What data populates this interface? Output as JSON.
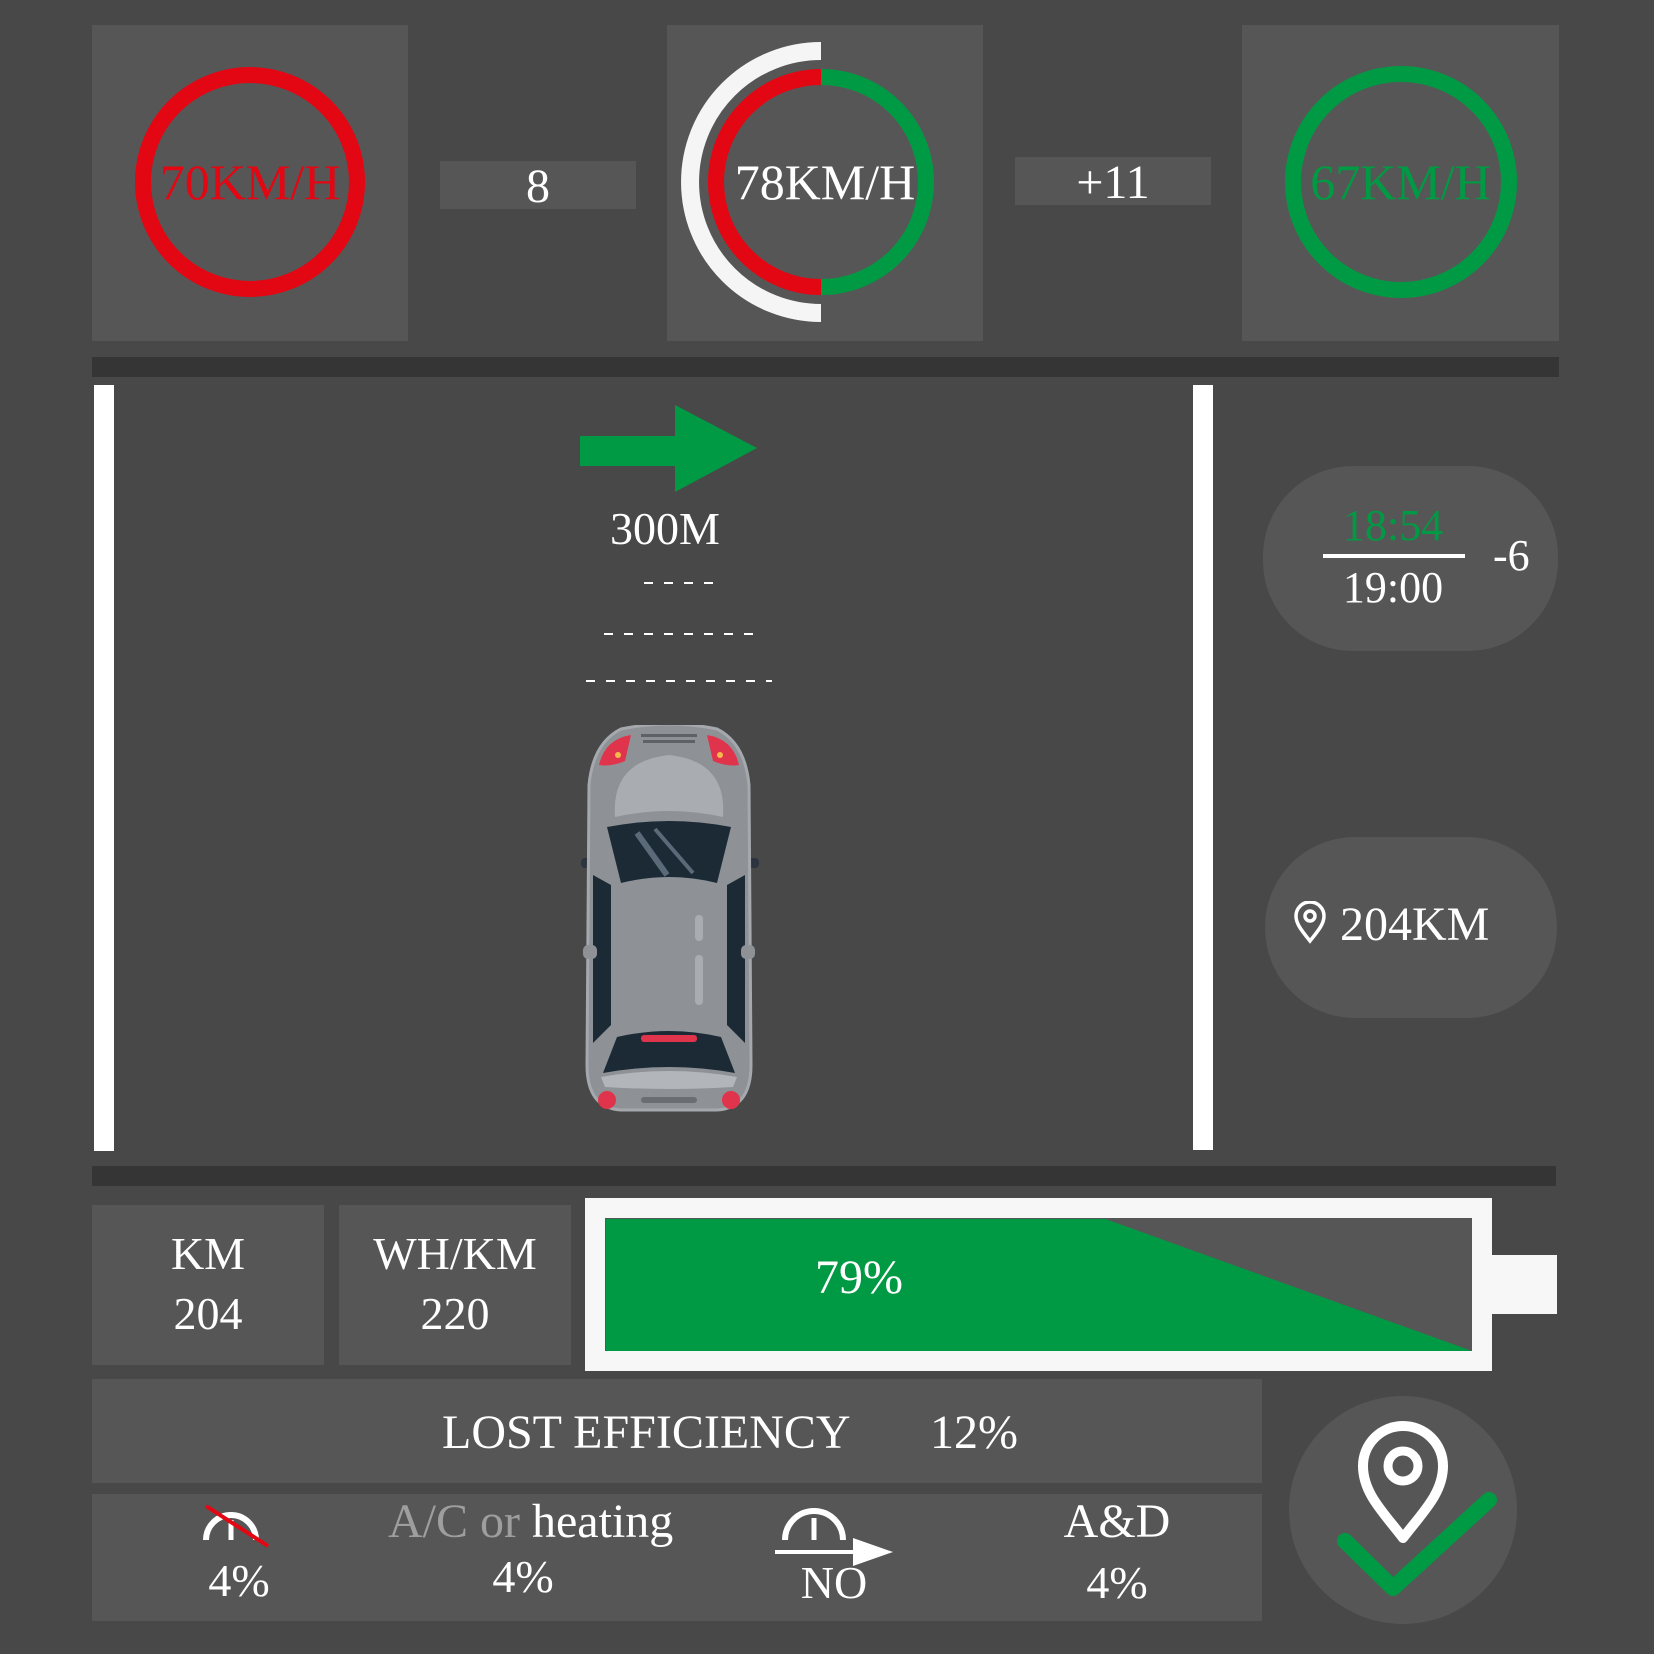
{
  "colors": {
    "background": "#484848",
    "panel": "#575656",
    "separator": "#353535",
    "red": "#e30613",
    "green": "#009a44",
    "white": "#ffffff",
    "grey_text": "#9e9e9e"
  },
  "speed": {
    "limit_prev": "70KM/H",
    "diff_prev": "8",
    "current": "78KM/H",
    "diff_next": "+11",
    "limit_next": "67KM/H",
    "current_gauge": {
      "red_fraction": 0.5,
      "green_fraction": 0.5
    }
  },
  "navigation": {
    "turn": "right-arrow-icon",
    "distance": "300M"
  },
  "eta": {
    "predicted": "18:54",
    "planned": "19:00",
    "delta": "-6"
  },
  "range_pill": {
    "icon": "location-pin-icon",
    "value": "204KM"
  },
  "stats": {
    "km_label": "KM",
    "km_value": "204",
    "whkm_label": "WH/KM",
    "whkm_value": "220"
  },
  "battery": {
    "percent_label": "79%",
    "level": 0.79
  },
  "efficiency": {
    "title": "LOST EFFICIENCY",
    "value": "12%",
    "items": [
      {
        "icon": "speedometer-crossed-icon",
        "value": "4%"
      },
      {
        "label_ac": "A/C",
        "label_or": "or",
        "label_heating": "heating",
        "value": "4%"
      },
      {
        "icon": "speedometer-arrow-icon",
        "value": "NO"
      },
      {
        "label": "A&D",
        "value": "4%"
      }
    ]
  },
  "destination": {
    "icon": "location-pin-check-icon"
  }
}
